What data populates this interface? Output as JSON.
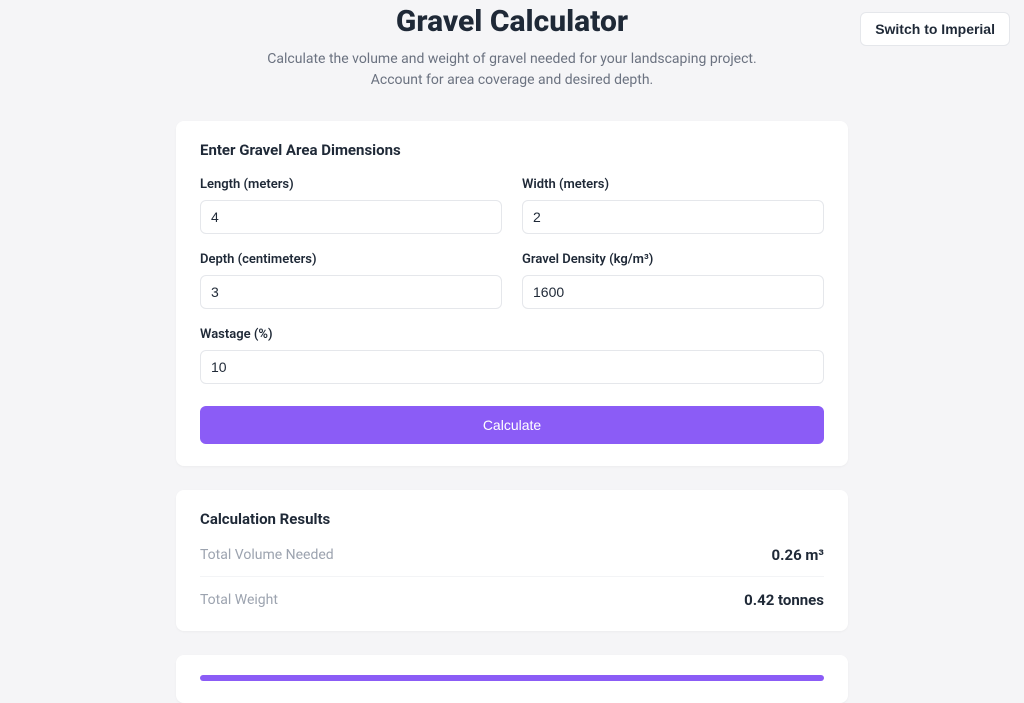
{
  "topButton": {
    "label": "Switch to Imperial"
  },
  "header": {
    "title": "Gravel Calculator",
    "subtitle": "Calculate the volume and weight of gravel needed for your landscaping project. Account for area coverage and desired depth."
  },
  "inputsCard": {
    "title": "Enter Gravel Area Dimensions",
    "fields": {
      "length": {
        "label": "Length (meters)",
        "value": "4"
      },
      "width": {
        "label": "Width (meters)",
        "value": "2"
      },
      "depth": {
        "label": "Depth (centimeters)",
        "value": "3"
      },
      "density": {
        "label": "Gravel Density (kg/m³)",
        "value": "1600"
      },
      "wastage": {
        "label": "Wastage (%)",
        "value": "10"
      }
    },
    "calculateLabel": "Calculate"
  },
  "resultsCard": {
    "title": "Calculation Results",
    "rows": {
      "volume": {
        "label": "Total Volume Needed",
        "value": "0.26 m³"
      },
      "weight": {
        "label": "Total Weight",
        "value": "0.42 tonnes"
      }
    }
  }
}
